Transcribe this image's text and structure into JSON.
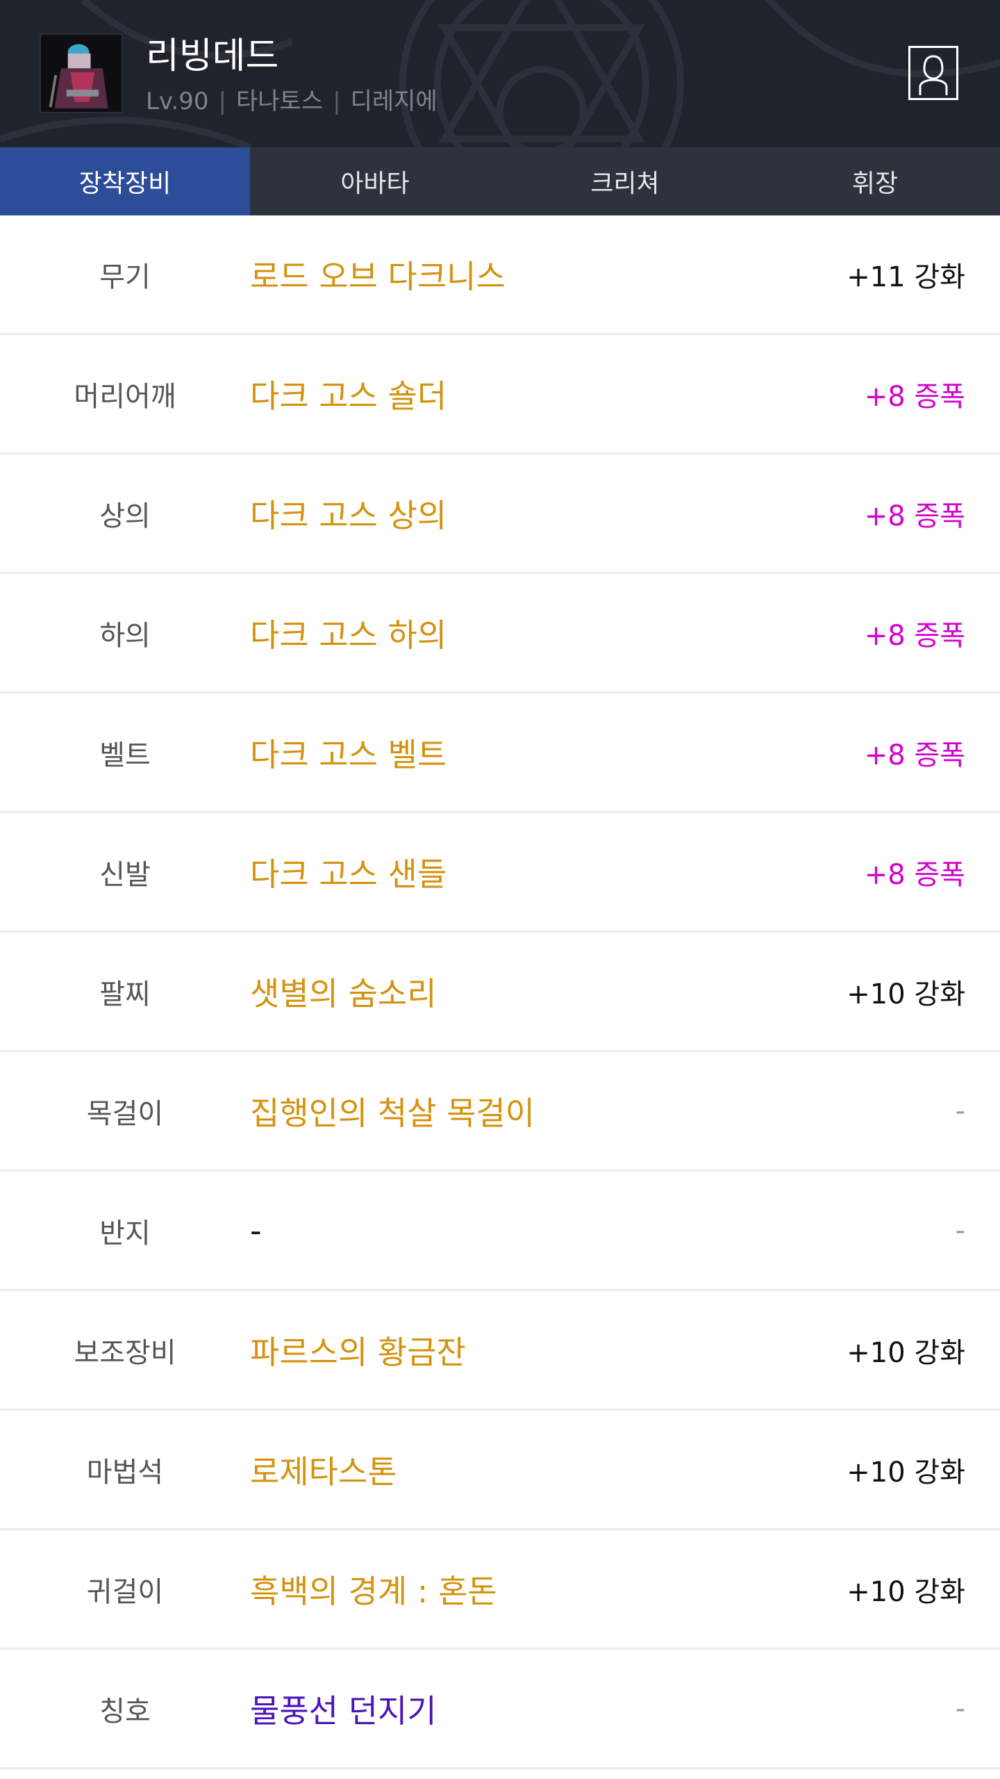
{
  "header": {
    "name": "리빙데드",
    "level": "Lv.90",
    "server": "타나토스",
    "job": "디레지에"
  },
  "tabs": [
    {
      "label": "장착장비",
      "active": true
    },
    {
      "label": "아바타",
      "active": false
    },
    {
      "label": "크리쳐",
      "active": false
    },
    {
      "label": "휘장",
      "active": false
    }
  ],
  "equipment": [
    {
      "slot": "무기",
      "item": "로드 오브 다크니스",
      "enhance": "+11 강화",
      "type": "reinforce"
    },
    {
      "slot": "머리어깨",
      "item": "다크 고스 숄더",
      "enhance": "+8 증폭",
      "type": "amplify"
    },
    {
      "slot": "상의",
      "item": "다크 고스 상의",
      "enhance": "+8 증폭",
      "type": "amplify"
    },
    {
      "slot": "하의",
      "item": "다크 고스 하의",
      "enhance": "+8 증폭",
      "type": "amplify"
    },
    {
      "slot": "벨트",
      "item": "다크 고스 벨트",
      "enhance": "+8 증폭",
      "type": "amplify"
    },
    {
      "slot": "신발",
      "item": "다크 고스 샌들",
      "enhance": "+8 증폭",
      "type": "amplify"
    },
    {
      "slot": "팔찌",
      "item": "샛별의 숨소리",
      "enhance": "+10 강화",
      "type": "reinforce"
    },
    {
      "slot": "목걸이",
      "item": "집행인의 척살 목걸이",
      "enhance": "-",
      "type": "none"
    },
    {
      "slot": "반지",
      "item": "-",
      "enhance": "-",
      "type": "none"
    },
    {
      "slot": "보조장비",
      "item": "파르스의 황금잔",
      "enhance": "+10 강화",
      "type": "reinforce"
    },
    {
      "slot": "마법석",
      "item": "로제타스톤",
      "enhance": "+10 강화",
      "type": "reinforce"
    },
    {
      "slot": "귀걸이",
      "item": "흑백의 경계 : 혼돈",
      "enhance": "+10 강화",
      "type": "reinforce"
    },
    {
      "slot": "칭호",
      "item": "물풍선 던지기",
      "enhance": "-",
      "type": "none"
    }
  ],
  "colors": {
    "item_name": "#d4920e",
    "title_name": "#4a13b8",
    "amplify": "#d400cf",
    "active_tab": "#2d4d98",
    "header_bg": "#1f232c"
  }
}
